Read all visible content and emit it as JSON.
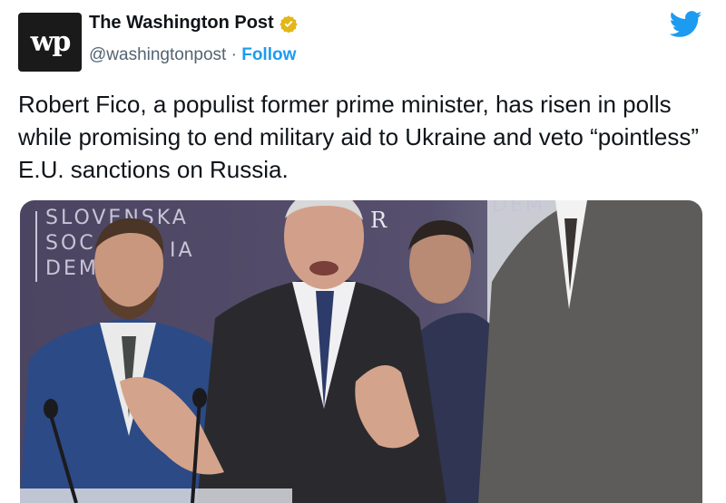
{
  "account": {
    "name": "The Washington Post",
    "handle": "@washingtonpost",
    "separator": "·",
    "follow_label": "Follow",
    "avatar_text": "wp"
  },
  "tweet": {
    "text": "Robert Fico, a populist former prime minister, has risen in polls while promising to end military aid to Ukraine and veto “pointless” E.U. sanctions on Russia."
  },
  "photo": {
    "backdrop_lines": [
      "SLOVENSKA",
      "SOC",
      "DEM",
      "IA"
    ],
    "backdrop_partial": [
      "R",
      "DEM"
    ]
  },
  "colors": {
    "accent": "#1d9bf0",
    "verified": "#e2b719",
    "backdrop": "#4f4a66"
  },
  "icons": {
    "verified": "verified-badge-icon",
    "brand": "twitter-bird-icon"
  }
}
